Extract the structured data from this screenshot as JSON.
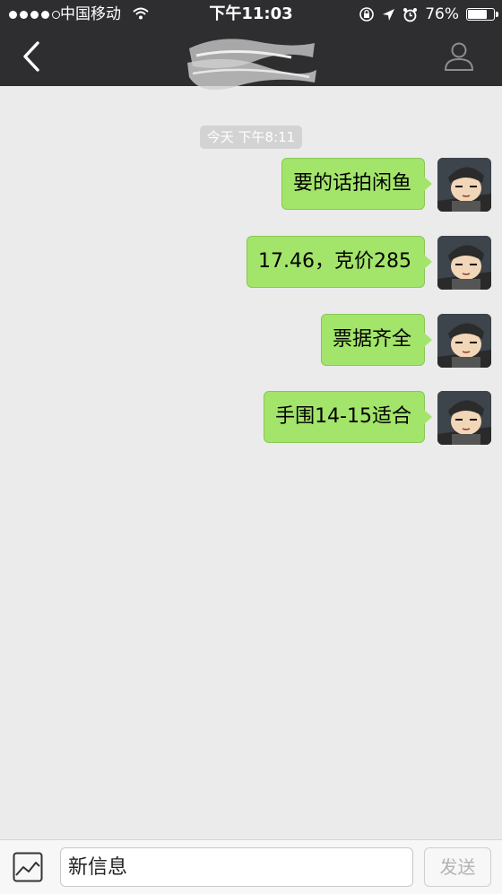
{
  "status_bar": {
    "carrier": "中国移动",
    "time": "下午11:03",
    "battery": "76%",
    "battery_level": 0.76,
    "signal_bars": 4,
    "icons": [
      "wifi-icon",
      "orientation-lock-icon",
      "location-arrow-icon",
      "alarm-icon",
      "battery-icon"
    ]
  },
  "nav": {
    "back_icon": "chevron-left-icon",
    "profile_icon": "person-icon"
  },
  "conversation": {
    "timestamp": "今天 下午8:11",
    "messages": [
      {
        "text": "要的话拍闲鱼",
        "sender": "me"
      },
      {
        "text": "17.46，克价285",
        "sender": "me"
      },
      {
        "text": "票据齐全",
        "sender": "me"
      },
      {
        "text": "手围14-15适合",
        "sender": "me"
      }
    ]
  },
  "composer": {
    "photo_icon": "image-icon",
    "placeholder": "新信息",
    "send_label": "发送"
  },
  "colors": {
    "nav_bg": "#2e2e30",
    "bubble": "#a3e46a",
    "background": "#ebebeb"
  }
}
